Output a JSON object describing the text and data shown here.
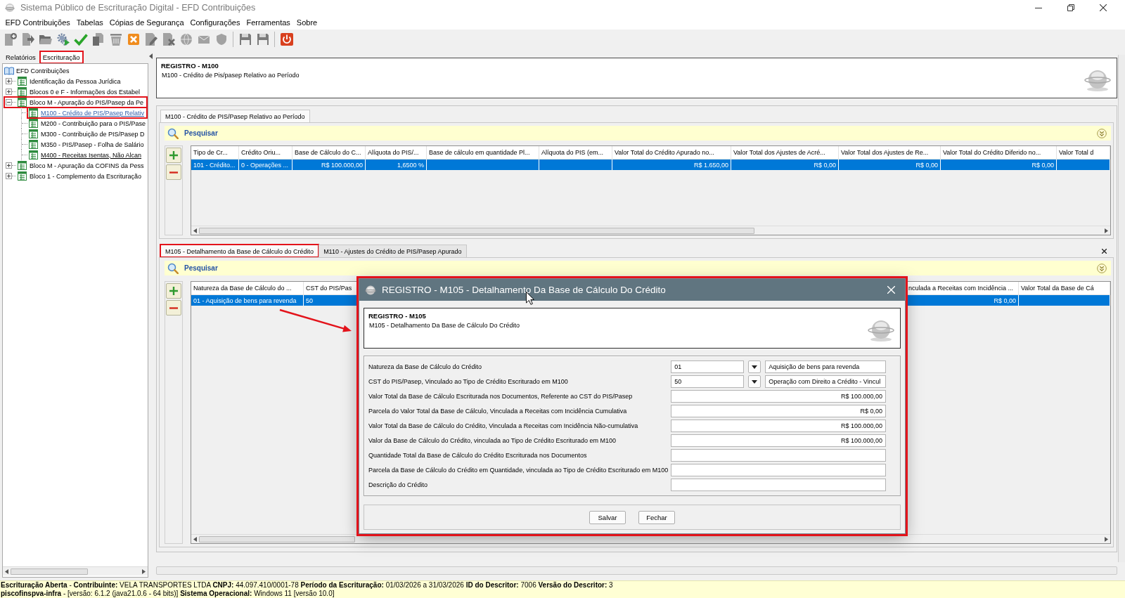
{
  "window": {
    "title": "Sistema Público de Escrituração Digital - EFD Contribuições"
  },
  "menu": [
    "EFD Contribuições",
    "Tabelas",
    "Cópias de Segurança",
    "Configurações",
    "Ferramentas",
    "Sobre"
  ],
  "toolbar": [
    {
      "buttons": [
        {
          "kind": "new",
          "disabled": true
        },
        {
          "kind": "export",
          "disabled": true
        },
        {
          "kind": "folder",
          "disabled": true
        },
        {
          "kind": "gears",
          "disabled": false
        },
        {
          "kind": "check",
          "disabled": false
        },
        {
          "kind": "import",
          "disabled": true
        },
        {
          "kind": "bin",
          "disabled": true
        },
        {
          "kind": "cancel",
          "disabled": false
        },
        {
          "kind": "edit",
          "disabled": true
        },
        {
          "kind": "delete",
          "disabled": true
        },
        {
          "kind": "globe",
          "disabled": true
        },
        {
          "kind": "mail",
          "disabled": true
        },
        {
          "kind": "shield",
          "disabled": true
        }
      ]
    },
    {
      "buttons": [
        {
          "kind": "save",
          "disabled": false
        },
        {
          "kind": "saveas",
          "disabled": false
        }
      ]
    },
    {
      "buttons": [
        {
          "kind": "exit",
          "disabled": false
        }
      ]
    }
  ],
  "left_panel": {
    "tabs": [
      {
        "label": "Relatórios",
        "selected": false,
        "highlighted": false
      },
      {
        "label": "Escrituração",
        "selected": true,
        "highlighted": true
      }
    ],
    "tree": {
      "label": "EFD Contribuições",
      "children": [
        {
          "label": "Identificação da Pessoa Jurídica",
          "expanded": false,
          "selected": false,
          "highlighted": false
        },
        {
          "label": "Blocos 0 e F - Informações dos Estabel",
          "expanded": false,
          "selected": false,
          "highlighted": false
        },
        {
          "label": "Bloco M - Apuração do PIS/Pasep da Pe",
          "expanded": true,
          "selected": false,
          "highlighted": true,
          "children": [
            {
              "label": "M100 - Crédito de PIS/Pasep Relativ",
              "selected": true,
              "highlighted": true,
              "hovered": false
            },
            {
              "label": "M200 - Contribuição para o PIS/Pase",
              "selected": false,
              "highlighted": false,
              "hovered": false
            },
            {
              "label": "M300 - Contribuição de PIS/Pasep D",
              "selected": false,
              "highlighted": false,
              "hovered": false
            },
            {
              "label": "M350 - PIS/Pasep - Folha de Salário",
              "selected": false,
              "highlighted": false,
              "hovered": false
            },
            {
              "label": "M400 - Receitas Isentas, Não Alcan",
              "selected": false,
              "highlighted": false,
              "hovered": true
            }
          ]
        },
        {
          "label": "Bloco M - Apuração da COFINS da Pess",
          "expanded": false,
          "selected": false,
          "highlighted": false
        },
        {
          "label": "Bloco 1 - Complemento da Escrituração",
          "expanded": false,
          "selected": false,
          "highlighted": false
        }
      ]
    }
  },
  "record_header": {
    "title": "REGISTRO - M100",
    "subtitle": "M100 - Crédito de Pis/pasep Relativo ao Período"
  },
  "upper_panel": {
    "tabs": [
      {
        "label": "M100 - Crédito de PIS/Pasep Relativo ao Período",
        "selected": true
      }
    ],
    "search": {
      "label": "Pesquisar"
    },
    "table": {
      "columns": [
        {
          "label": "Tipo de Cr...",
          "kind": "text"
        },
        {
          "label": "Crédito Oriu...",
          "kind": "text"
        },
        {
          "label": "Base de Cálculo do C...",
          "kind": "amount"
        },
        {
          "label": "Alíquota do PIS/...",
          "kind": "amount"
        },
        {
          "label": "Base de cálculo em quantidade Pl..."
        },
        {
          "label": "Alíquota do PIS (em..."
        },
        {
          "label": "Valor Total do Crédito Apurado no...",
          "kind": "amount"
        },
        {
          "label": "Valor Total dos Ajustes de Acré...",
          "kind": "amount"
        },
        {
          "label": "Valor Total dos Ajustes de Re...",
          "kind": "amount"
        },
        {
          "label": "Valor Total do Crédito Diferido no...",
          "kind": "amount"
        },
        {
          "label": "Valor Total d"
        }
      ],
      "rows": [
        {
          "selected": true,
          "cells": [
            "101 - Crédito...",
            "0 - Operações ...",
            "R$ 100.000,00",
            "1,6500 %",
            null,
            null,
            "R$ 1.650,00",
            "R$ 0,00",
            "R$ 0,00",
            "R$ 0,00",
            null
          ]
        }
      ]
    }
  },
  "lower_panel": {
    "tabs": [
      {
        "label": "M105 - Detalhamento da Base de Cálculo do Crédito",
        "selected": true,
        "highlighted": true
      },
      {
        "label": "M110 - Ajustes do Crédito de PIS/Pasep Apurado",
        "selected": false,
        "highlighted": false
      }
    ],
    "search": {
      "label": "Pesquisar"
    },
    "table": {
      "columns": [
        {
          "label": "Natureza da Base de Cálculo do ...",
          "kind": "text"
        },
        {
          "label": "CST do PIS/Pas",
          "kind": "text"
        },
        {
          "label": "nculada a Receitas com Incidência ...",
          "kind": "amount"
        },
        {
          "label": "Valor Total da Base de Cá"
        }
      ],
      "rows": [
        {
          "selected": true,
          "cells": [
            "01 - Aquisição de bens para revenda",
            "50",
            "R$ 0,00",
            null
          ]
        }
      ]
    }
  },
  "dialog": {
    "title": "REGISTRO - M105 - Detalhamento Da Base de Cálculo Do Crédito",
    "highlighted": true,
    "header": {
      "title": "REGISTRO - M105",
      "subtitle": "M105 - Detalhamento Da Base de Cálculo Do Crédito"
    },
    "fields": [
      {
        "kind": "lookup",
        "label": "Natureza da Base de Cálculo do Crédito",
        "value": "01",
        "description": "Aquisição de bens para revenda"
      },
      {
        "kind": "lookup",
        "label": "CST do PIS/Pasep, Vinculado ao Tipo de Crédito Escriturado em M100",
        "value": "50",
        "description": "Operação com Direito a Crédito - Vincul"
      },
      {
        "kind": "field",
        "label": "Valor Total da Base de Cálculo Escriturada nos Documentos, Referente ao CST do PIS/Pasep",
        "value": "R$ 100.000,00"
      },
      {
        "kind": "field",
        "label": "Parcela do Valor Total da Base de Cálculo, Vinculada a Receitas com Incidência Cumulativa",
        "value": "R$ 0,00"
      },
      {
        "kind": "field",
        "label": "Valor Total da Base de Cálculo do Crédito, Vinculada a Receitas com Incidência Não-cumulativa",
        "value": "R$ 100.000,00"
      },
      {
        "kind": "field",
        "label": "Valor da Base de Cálculo do Crédito, vinculada ao Tipo de Crédito Escriturado em M100",
        "value": "R$ 100.000,00"
      },
      {
        "kind": "field",
        "label": "Quantidade Total da Base de Cálculo do Crédito Escriturada nos Documentos"
      },
      {
        "kind": "field",
        "label": "Parcela da Base de Cálculo do Crédito em Quantidade, vinculada ao Tipo de Crédito Escriturado em M100"
      },
      {
        "kind": "field",
        "label": "Descrição do Crédito"
      }
    ],
    "buttons": [
      "Salvar",
      "Fechar"
    ]
  },
  "status_bar": {
    "lines": [
      "**Escrituração Aberta** - **Contribuinte:** VELA TRANSPORTES LTDA **CNPJ:** 44.097.410/0001-78 **Período da Escrituração:** 01/03/2026 a 31/03/2026 **ID do Descritor:** 7006 **Versão do Descritor:** 3",
      "**piscofinspva-infra** - [versão: 6.1.2 (java21.0.6 - 64 bits)] **Sistema Operacional:** Windows 11 [versão 10.0]"
    ]
  }
}
